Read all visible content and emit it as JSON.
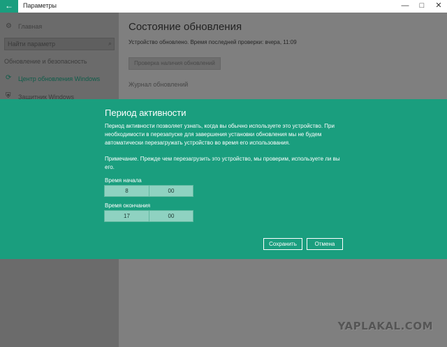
{
  "window": {
    "back_icon": "←",
    "title": "Параметры",
    "minimize_icon": "—",
    "maximize_icon": "□",
    "close_icon": "✕"
  },
  "sidebar": {
    "home_icon": "⚙",
    "home_label": "Главная",
    "search_placeholder": "Найти параметр",
    "search_icon": "⌕",
    "section_label": "Обновление и безопасность",
    "items": [
      {
        "icon": "⟳",
        "label": "Центр обновления Windows",
        "active": true
      },
      {
        "icon": "⛨",
        "label": "Защитник Windows",
        "active": false
      }
    ]
  },
  "main": {
    "title": "Состояние обновления",
    "status": "Устройство обновлено. Время последней проверки: вчера, 11:09",
    "check_button": "Проверка наличия обновлений",
    "journal_link": "Журнал обновлений"
  },
  "dialog": {
    "title": "Период активности",
    "description": "Период активности позволяет узнать, когда вы обычно используете это устройство. При необходимости в перезапуске для завершения установки обновления мы не будем автоматически перезагружать устройство во время его использования.",
    "note": "Примечание. Прежде чем перезагрузить это устройство, мы проверим, используете ли вы его.",
    "start_label": "Время начала",
    "start_hour": "8",
    "start_minute": "00",
    "end_label": "Время окончания",
    "end_hour": "17",
    "end_minute": "00",
    "save_button": "Сохранить",
    "cancel_button": "Отмена"
  },
  "watermark": "YAPLAKAL.COM",
  "colors": {
    "accent": "#1a9e7e",
    "overlay": "#7f7f7f",
    "picker": "#8fd2c1"
  }
}
